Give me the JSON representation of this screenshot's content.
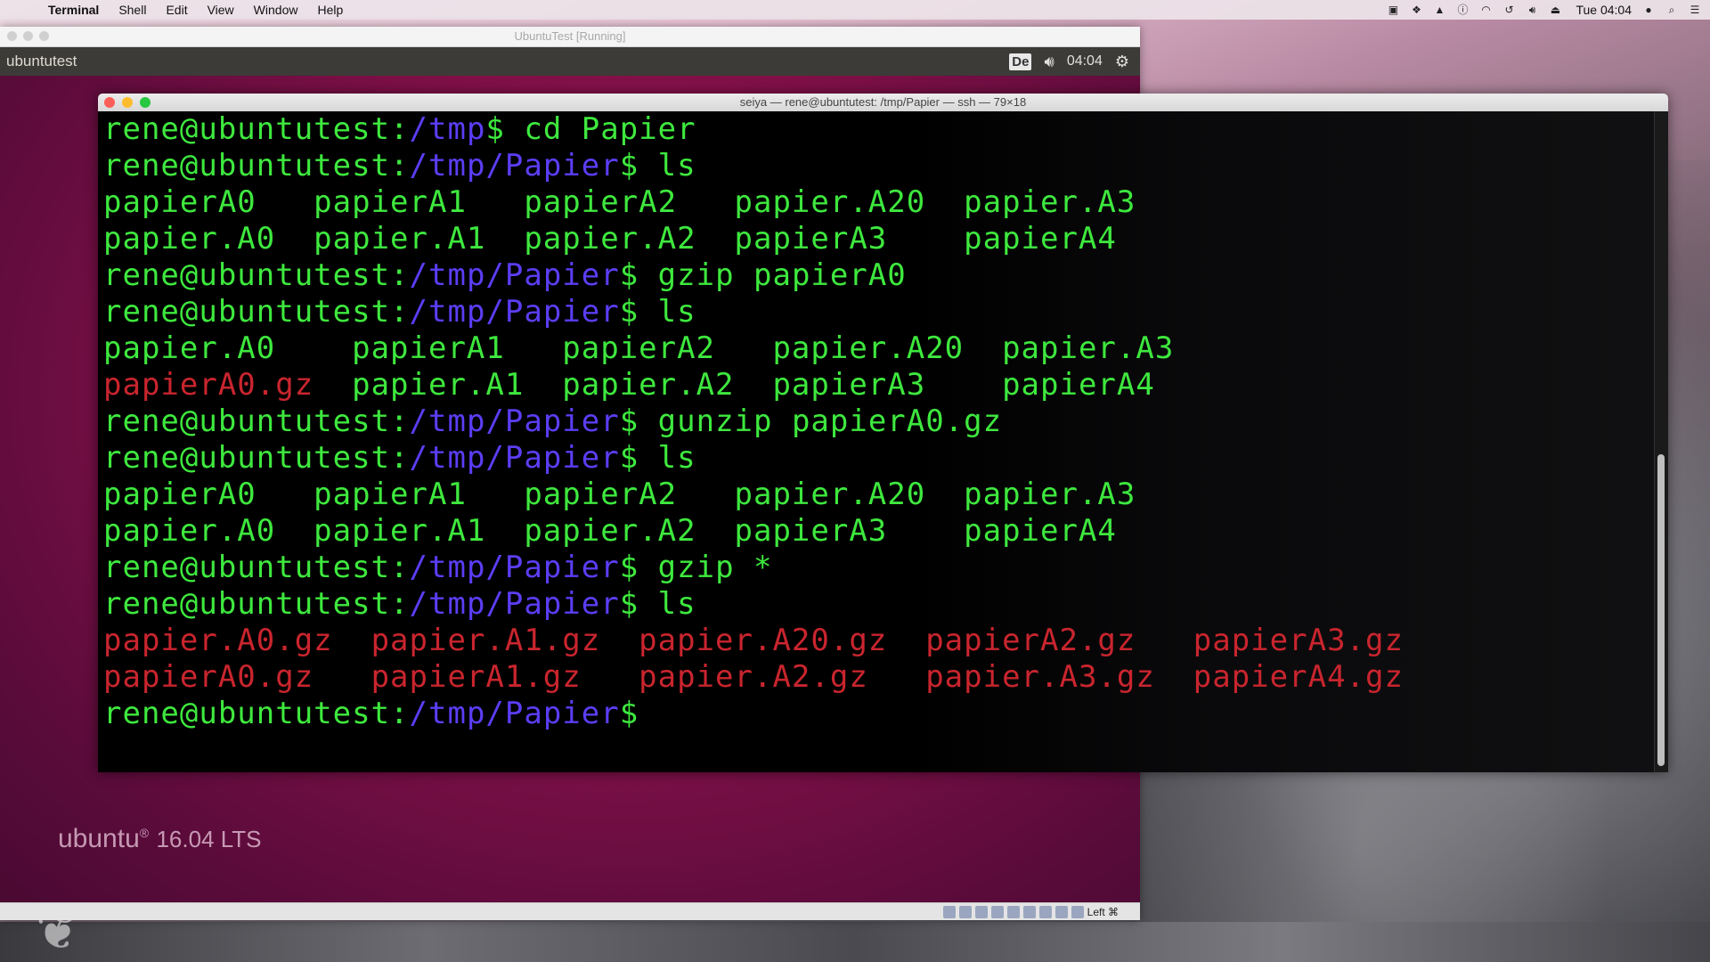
{
  "menubar": {
    "app_name": "Terminal",
    "items": [
      "Shell",
      "Edit",
      "View",
      "Window",
      "Help"
    ],
    "clock": "Tue 04:04"
  },
  "vbox": {
    "title": "UbuntuTest [Running]",
    "statusbar_text": "Left ⌘"
  },
  "ubuntu": {
    "hostname": "ubuntutest",
    "keyboard": "De",
    "clock": "04:04",
    "logo": "ubuntu",
    "version": "16.04 LTS"
  },
  "terminal": {
    "title": "seiya — rene@ubuntutest: /tmp/Papier — ssh — 79×18",
    "prompt_user": "rene@ubuntutest",
    "lines": [
      {
        "type": "cmd",
        "path": "/tmp",
        "cmd": " cd Papier"
      },
      {
        "type": "cmd",
        "path": "/tmp/Papier",
        "cmd": " ls"
      },
      {
        "type": "out",
        "text": "papierA0   papierA1   papierA2   papier.A20  papier.A3"
      },
      {
        "type": "out",
        "text": "papier.A0  papier.A1  papier.A2  papierA3    papierA4"
      },
      {
        "type": "cmd",
        "path": "/tmp/Papier",
        "cmd": " gzip papierA0"
      },
      {
        "type": "cmd",
        "path": "/tmp/Papier",
        "cmd": " ls"
      },
      {
        "type": "out",
        "text": "papier.A0    papierA1   papierA2   papier.A20  papier.A3"
      },
      {
        "type": "mixed",
        "red": "papierA0.gz",
        "rest": "  papier.A1  papier.A2  papierA3    papierA4"
      },
      {
        "type": "cmd",
        "path": "/tmp/Papier",
        "cmd": " gunzip papierA0.gz"
      },
      {
        "type": "cmd",
        "path": "/tmp/Papier",
        "cmd": " ls"
      },
      {
        "type": "out",
        "text": "papierA0   papierA1   papierA2   papier.A20  papier.A3"
      },
      {
        "type": "out",
        "text": "papier.A0  papier.A1  papier.A2  papierA3    papierA4"
      },
      {
        "type": "cmd",
        "path": "/tmp/Papier",
        "cmd": " gzip *"
      },
      {
        "type": "cmd",
        "path": "/tmp/Papier",
        "cmd": " ls"
      },
      {
        "type": "red",
        "text": "papier.A0.gz  papier.A1.gz  papier.A20.gz  papierA2.gz   papierA3.gz"
      },
      {
        "type": "red",
        "text": "papierA0.gz   papierA1.gz   papier.A2.gz   papier.A3.gz  papierA4.gz"
      },
      {
        "type": "cmd",
        "path": "/tmp/Papier",
        "cmd": ""
      }
    ]
  },
  "colors": {
    "prompt_green": "#3ee83e",
    "path_blue": "#5a3ef5",
    "archive_red": "#c9252e"
  }
}
